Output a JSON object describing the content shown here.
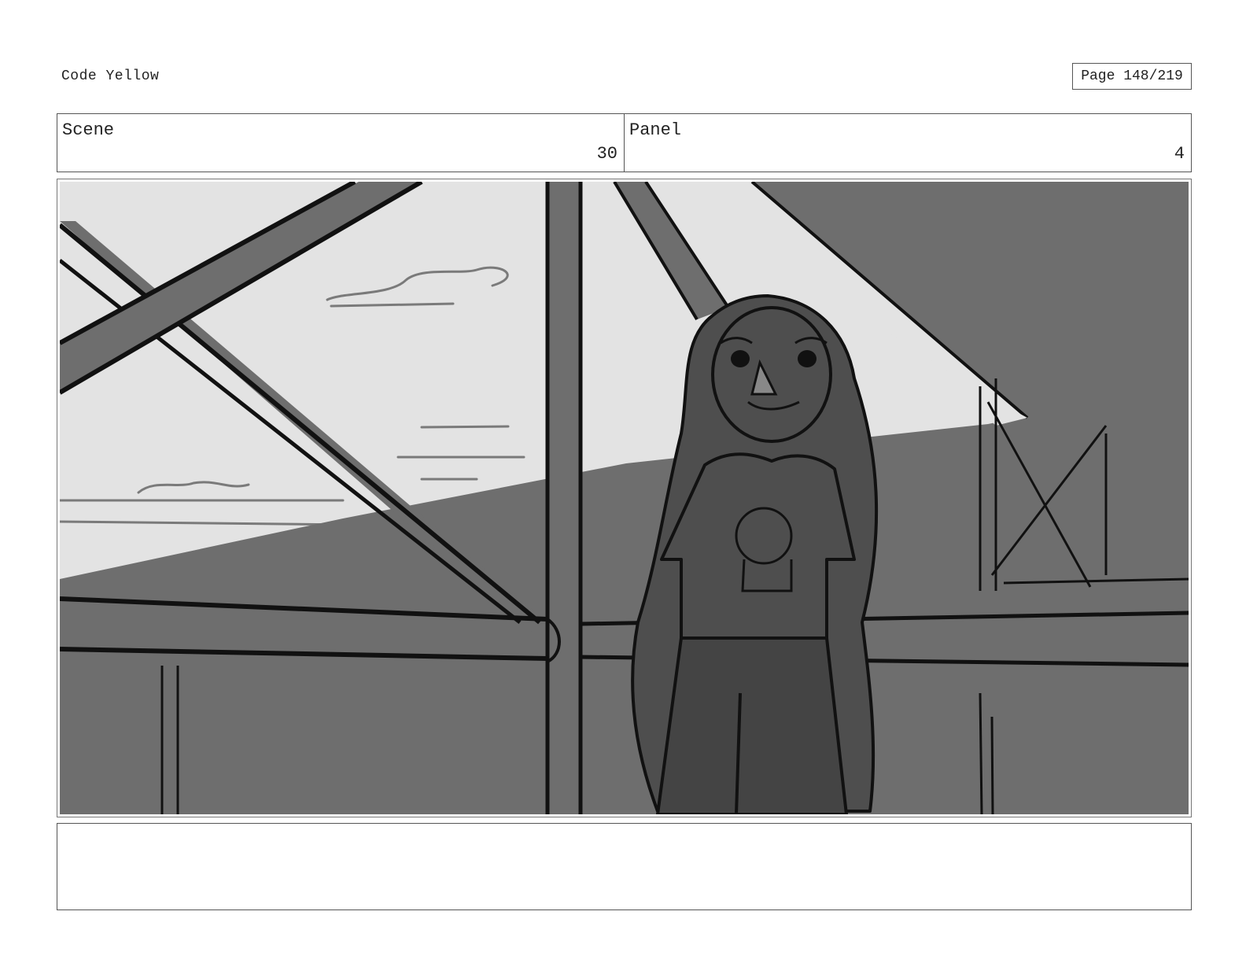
{
  "header": {
    "title": "Code Yellow",
    "page": "Page 148/219"
  },
  "info": {
    "scene_label": "Scene",
    "scene_value": "30",
    "panel_label": "Panel",
    "panel_value": "4"
  },
  "colors": {
    "sky": "#e3e3e3",
    "ground": "#6e6e6e",
    "figure": "#4e4e4e",
    "ink": "#111111"
  },
  "notes": ""
}
